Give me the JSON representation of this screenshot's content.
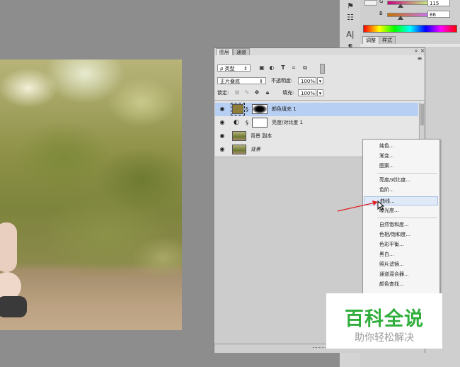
{
  "color_sliders": {
    "g_label": "G",
    "g_value": "115",
    "b_label": "B",
    "b_value": "86"
  },
  "panel_tabs": {
    "adjust": "调整",
    "style": "样式"
  },
  "layers_panel": {
    "tab_layers": "图层",
    "tab_channels": "通道",
    "filter_kind": "ρ 类型",
    "blend_mode": "正片叠底",
    "opacity_label": "不透明度:",
    "opacity_value": "100%",
    "lock_label": "锁定:",
    "fill_label": "填充:",
    "fill_value": "100%",
    "layers": [
      {
        "name": "颜色填充 1"
      },
      {
        "name": "亮度/对比度 1"
      },
      {
        "name": "背景 副本"
      },
      {
        "name": "背景"
      }
    ]
  },
  "context_menu": {
    "items": [
      "纯色...",
      "渐变...",
      "图案...",
      "亮度/对比度...",
      "色阶...",
      "曲线...",
      "曝光度...",
      "自然饱和度...",
      "色相/饱和度...",
      "色彩平衡...",
      "黑白...",
      "照片滤镜...",
      "通道混合器...",
      "颜色查找..."
    ]
  },
  "watermark": {
    "title": "百科全说",
    "subtitle": "助你轻松解决"
  },
  "colors": {
    "selected_row": "#b7cff2",
    "arrow": "#e02020",
    "watermark_green": "#2fae3b"
  }
}
